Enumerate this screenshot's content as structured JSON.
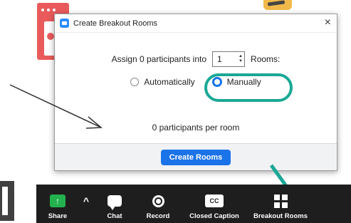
{
  "dialog": {
    "title": "Create Breakout Rooms",
    "close": "×",
    "assign_prefix": "Assign 0 participants into",
    "rooms_count": "1",
    "rooms_suffix": "Rooms:",
    "option_auto": "Automatically",
    "option_manual": "Manually",
    "selected_option": "Manually",
    "per_room": "0 participants per room",
    "create_button": "Create Rooms"
  },
  "toolbar": {
    "share": "Share",
    "share_glyph": "↑",
    "caret": "^",
    "chat": "Chat",
    "record": "Record",
    "cc_glyph": "CC",
    "closed_caption": "Closed Caption",
    "breakout_rooms": "Breakout Rooms"
  },
  "colors": {
    "accent_blue": "#1a73e8",
    "highlight_teal": "#1aa896",
    "toolbar_bg": "#1e1e1e",
    "share_green": "#23b14d"
  },
  "icons": {
    "app": "zoom-camera-icon",
    "close": "close-icon",
    "share": "share-screen-icon",
    "chat": "chat-icon",
    "record": "record-icon",
    "cc": "closed-caption-icon",
    "breakout": "breakout-rooms-icon"
  }
}
